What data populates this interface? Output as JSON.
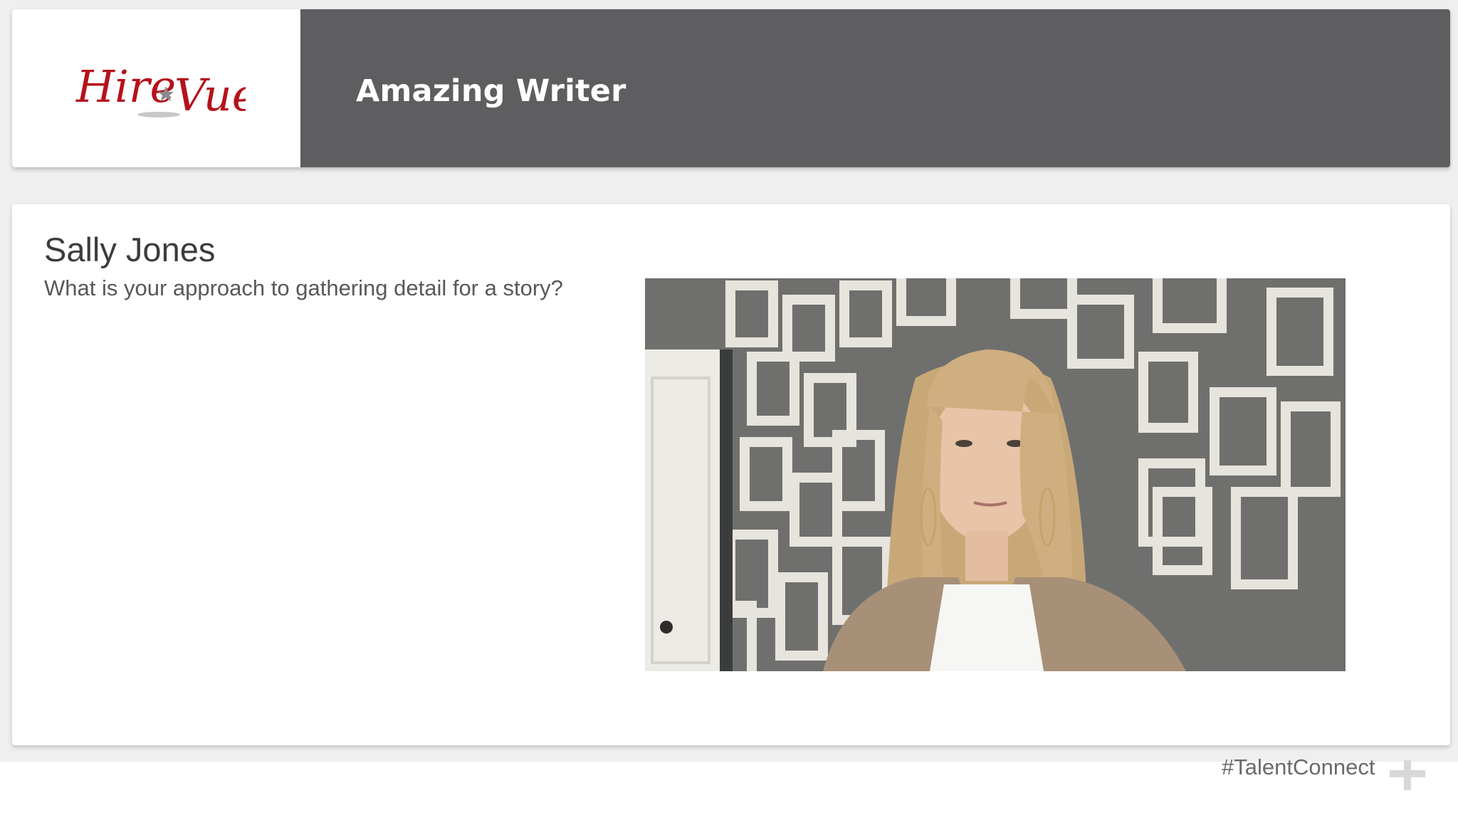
{
  "header": {
    "logo": {
      "text_left": "Hire",
      "text_right": "Vue",
      "brand_color": "#b5121b"
    },
    "job_title": "Amazing Writer",
    "background_color": "#5e5e60"
  },
  "candidate": {
    "name": "Sally Jones",
    "question": "What is your approach to gathering detail for a story?"
  },
  "video": {
    "content": "candidate-video-feed"
  },
  "footer": {
    "hashtag": "#TalentConnect",
    "icon": "plus-icon"
  }
}
